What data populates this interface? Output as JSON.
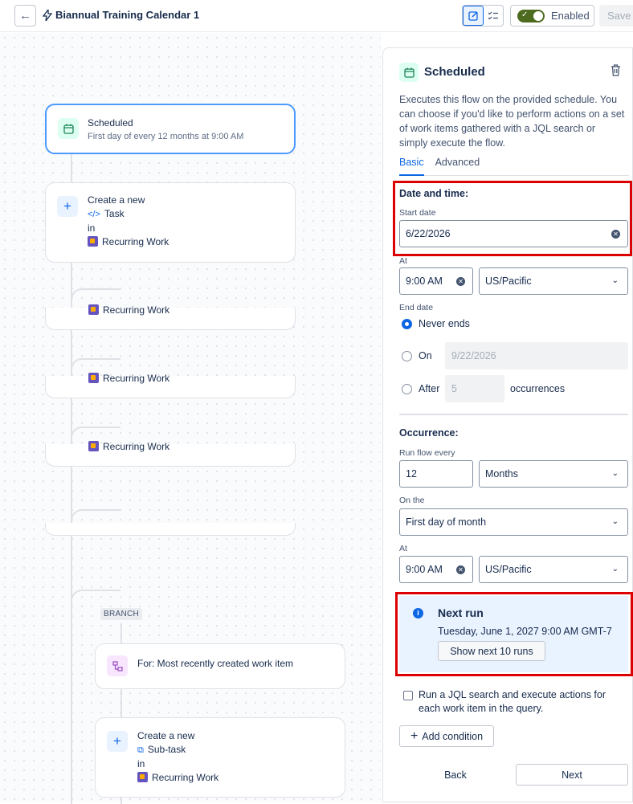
{
  "header": {
    "flow_title": "Biannual Training Calendar 1",
    "enabled_label": "Enabled",
    "save_label": "Save"
  },
  "canvas": {
    "trigger": {
      "title": "Scheduled",
      "subtitle": "First day of every 12 months at 9:00 AM"
    },
    "action": {
      "line1": "Create a new",
      "type": "Task",
      "in": "in",
      "project": "Recurring Work"
    },
    "collapsed_projects": [
      "Recurring Work",
      "Recurring Work",
      "Recurring Work"
    ],
    "branch_tag": "BRANCH",
    "branch_node": "For: Most recently created work item",
    "sub_action": {
      "line1": "Create a new",
      "type": "Sub-task",
      "in": "in",
      "project": "Recurring Work"
    }
  },
  "panel": {
    "title": "Scheduled",
    "description": "Executes this flow on the provided schedule. You can choose if you'd like to perform actions on a set of work items gathered with a JQL search or simply execute the flow.",
    "tabs": [
      {
        "label": "Basic",
        "active": true
      },
      {
        "label": "Advanced",
        "active": false
      }
    ],
    "date_time": {
      "section": "Date and time:",
      "start_label": "Start date",
      "start_value": "6/22/2026",
      "at_label": "At",
      "time_value": "9:00 AM",
      "timezone_value": "US/Pacific"
    },
    "end_date": {
      "label": "End date",
      "never_label": "Never ends",
      "on_label": "On",
      "on_value": "9/22/2026",
      "after_label": "After",
      "after_value": "5",
      "occurrences_label": "occurrences",
      "selected": "never"
    },
    "occurrence": {
      "section": "Occurrence:",
      "run_every_label": "Run flow every",
      "every_value": "12",
      "unit_value": "Months",
      "on_the_label": "On the",
      "on_the_value": "First day of month",
      "at_label": "At",
      "time_value": "9:00 AM",
      "timezone_value": "US/Pacific"
    },
    "next_run": {
      "title": "Next run",
      "datetime": "Tuesday, June 1, 2027 9:00 AM GMT-7",
      "show_button": "Show next 10 runs"
    },
    "jql_checkbox_label": "Run a JQL search and execute actions for each work item in the query.",
    "add_condition": "Add condition",
    "back_label": "Back",
    "next_label": "Next"
  },
  "colors": {
    "accent": "#0c66e4",
    "highlight_border": "#dd0000",
    "toggle_on": "#4c6b1f"
  }
}
